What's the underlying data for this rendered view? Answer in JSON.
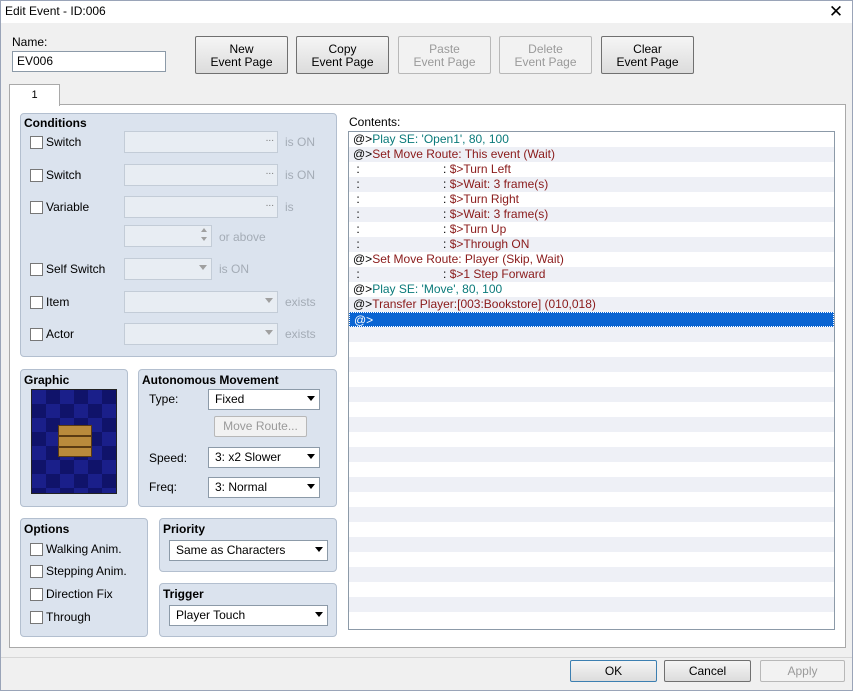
{
  "window": {
    "title": "Edit Event - ID:006",
    "close_glyph": "✕"
  },
  "name": {
    "label": "Name:",
    "value": "EV006"
  },
  "page_buttons": [
    {
      "line1": "New",
      "line2": "Event Page"
    },
    {
      "line1": "Copy",
      "line2": "Event Page"
    },
    {
      "line1": "Paste",
      "line2": "Event Page"
    },
    {
      "line1": "Delete",
      "line2": "Event Page"
    },
    {
      "line1": "Clear",
      "line2": "Event Page"
    }
  ],
  "tabs": [
    "1"
  ],
  "conditions": {
    "title": "Conditions",
    "switch1": "Switch",
    "switch2": "Switch",
    "variable": "Variable",
    "self_switch": "Self Switch",
    "item": "Item",
    "actor": "Actor",
    "is_on": "is ON",
    "is": "is",
    "or_above": "or above",
    "exists": "exists",
    "dots": "..."
  },
  "graphic": {
    "title": "Graphic"
  },
  "autonomous": {
    "title": "Autonomous Movement",
    "type_label": "Type:",
    "type_value": "Fixed",
    "move_route": "Move Route...",
    "speed_label": "Speed:",
    "speed_value": "3: x2 Slower",
    "freq_label": "Freq:",
    "freq_value": "3: Normal"
  },
  "options": {
    "title": "Options",
    "items": [
      "Walking Anim.",
      "Stepping Anim.",
      "Direction Fix",
      "Through"
    ]
  },
  "priority": {
    "title": "Priority",
    "value": "Same as Characters"
  },
  "trigger": {
    "title": "Trigger",
    "value": "Player Touch"
  },
  "contents": {
    "label": "Contents:",
    "lines": [
      {
        "prefix": "@>",
        "text": "Play SE: 'Open1', 80, 100",
        "color": "teal"
      },
      {
        "prefix": "@>",
        "text": "Set Move Route: This event (Wait)",
        "color": "red"
      },
      {
        "prefix": " :                         : ",
        "text": "$>Turn Left",
        "color": "red"
      },
      {
        "prefix": " :                         : ",
        "text": "$>Wait: 3 frame(s)",
        "color": "red"
      },
      {
        "prefix": " :                         : ",
        "text": "$>Turn Right",
        "color": "red"
      },
      {
        "prefix": " :                         : ",
        "text": "$>Wait: 3 frame(s)",
        "color": "red"
      },
      {
        "prefix": " :                         : ",
        "text": "$>Turn Up",
        "color": "red"
      },
      {
        "prefix": " :                         : ",
        "text": "$>Through ON",
        "color": "red"
      },
      {
        "prefix": "@>",
        "text": "Set Move Route: Player (Skip, Wait)",
        "color": "red"
      },
      {
        "prefix": " :                         : ",
        "text": "$>1 Step Forward",
        "color": "red"
      },
      {
        "prefix": "@>",
        "text": "Play SE: 'Move', 80, 100",
        "color": "teal"
      },
      {
        "prefix": "@>",
        "text": "Transfer Player:[003:Bookstore] (010,018)",
        "color": "red"
      },
      {
        "prefix": "@>",
        "text": "",
        "color": "sel"
      }
    ]
  },
  "footer": {
    "ok": "OK",
    "cancel": "Cancel",
    "apply": "Apply"
  },
  "colors": {
    "selection": "#0a64d2",
    "teal_text": "#0a7a7a",
    "red_text": "#8a1a1a",
    "group_bg": "#dbe3ee"
  }
}
